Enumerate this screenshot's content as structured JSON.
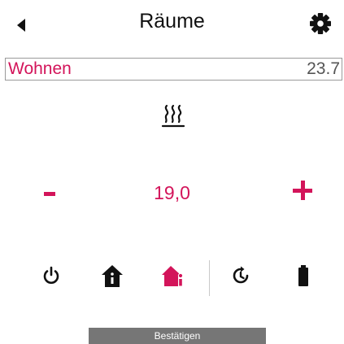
{
  "header": {
    "title": "Räume",
    "back_icon": "back-arrow-icon",
    "settings_icon": "gear-icon"
  },
  "room": {
    "name": "Wohnen",
    "current_temperature": "23.7"
  },
  "heating": {
    "icon": "heating-icon"
  },
  "setpoint": {
    "value": "19,0",
    "decrease_icon": "minus-icon",
    "increase_icon": "plus-icon"
  },
  "modes": [
    {
      "name": "power",
      "icon": "power-icon"
    },
    {
      "name": "home",
      "icon": "home-info-icon"
    },
    {
      "name": "home-active",
      "icon": "home-info-person-icon"
    },
    {
      "name": "timer",
      "icon": "timer-icon"
    },
    {
      "name": "battery",
      "icon": "battery-icon"
    }
  ],
  "confirm": {
    "label": "Bestätigen"
  },
  "colors": {
    "accent": "#d3145a",
    "text": "#111111",
    "border": "#9a9a9a",
    "button_bg": "#767676",
    "button_text": "#ffffff"
  }
}
